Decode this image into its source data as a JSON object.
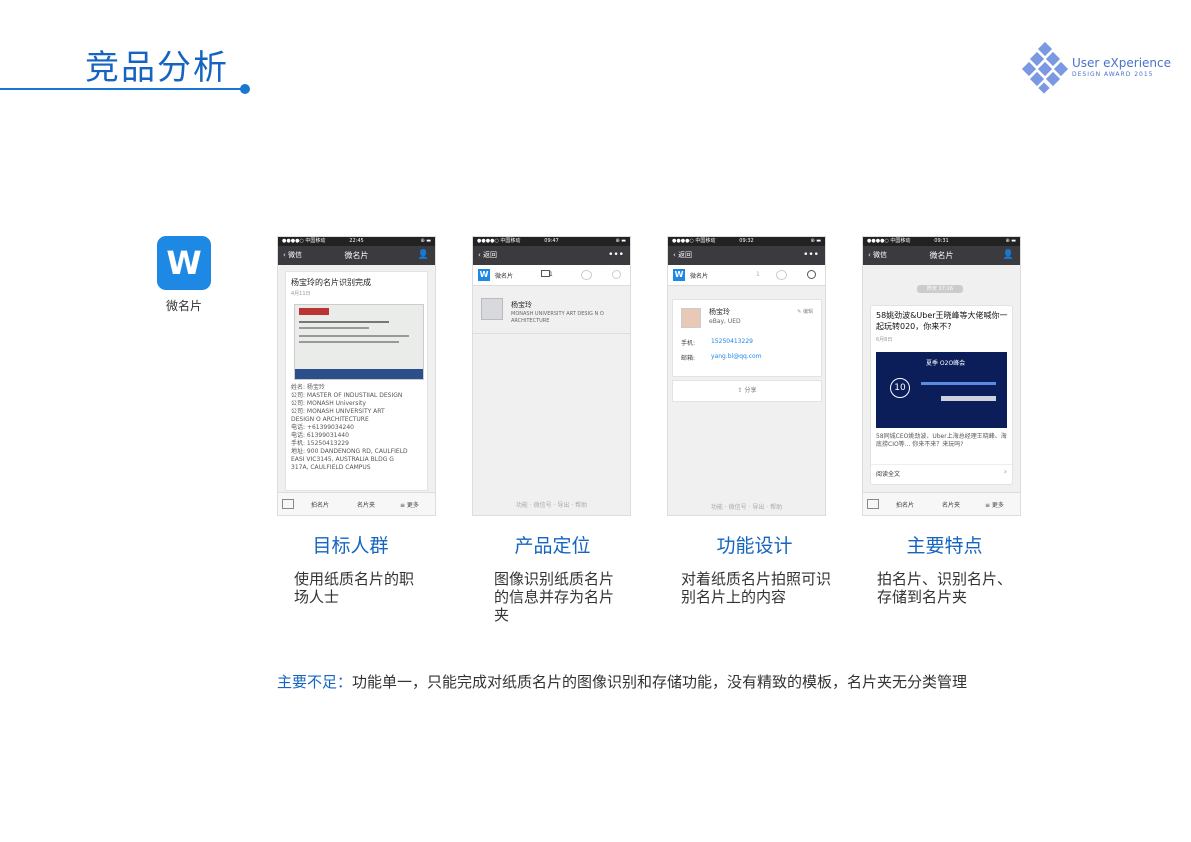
{
  "header": {
    "title": "竞品分析"
  },
  "logo": {
    "line1": "User eXperience",
    "line2": "DESIGN AWARD 2015"
  },
  "app": {
    "icon_letter": "W",
    "label": "微名片"
  },
  "phones": [
    {
      "status": {
        "carrier": "●●●●○ 中国移动 ",
        "time": "22:45",
        "battery": "⊕ ▬"
      },
      "nav": {
        "back": "‹ 微信",
        "title": "微名片",
        "right": "👤"
      },
      "card_title": "杨宝玲的名片识别完成",
      "card_date": "4月11日",
      "fields": [
        "姓名: 杨宝玲",
        "公司: MASTER OF INDUSTIIAL DESIGN",
        "公司: MONASH University",
        "公司: MONASH UNIVERSITY ART",
        "DESIGN O ARCHITECTURE",
        "电话: +61399034240",
        "电话: 61399031440",
        "手机: 15250413229",
        "地址: 900 DANDENONG RD, CAULFIELD",
        "EASI VIC3145, AUSTRALIA BLDG G",
        "317A, CAULFIELD CAMPUS"
      ],
      "tabs": [
        "拍名片",
        "名片夹",
        "≡ 更多"
      ]
    },
    {
      "status": {
        "carrier": "●●●●○ 中国移动 ",
        "time": "09:47",
        "battery": "⊕ ▬"
      },
      "nav": {
        "back": "‹ 返回",
        "title": "",
        "right": "•••"
      },
      "subhdr": {
        "name": "微名片",
        "count": "1"
      },
      "contact_name": "杨宝玲",
      "contact_org": "MONASH UNIVERSITY ART DESIG N O ARCHITECTURE",
      "footer": "功能 · 微信号 · 导出 · 帮助"
    },
    {
      "status": {
        "carrier": "●●●●○ 中国移动 ",
        "time": "09:32",
        "battery": "⊕ ▬"
      },
      "nav": {
        "back": "‹ 返回",
        "title": "",
        "right": "•••"
      },
      "subhdr": {
        "name": "微名片",
        "count": "1"
      },
      "contact_name": "杨宝玲",
      "contact_org": "eBay, UED",
      "edit": "✎ 编辑",
      "phone_label": "手机:",
      "phone_value": "15250413229",
      "email_label": "邮箱:",
      "email_value": "yang.bl@qq.com",
      "share": "⇪ 分享",
      "footer": "功能 · 微信号 · 导出 · 帮助"
    },
    {
      "status": {
        "carrier": "●●●●○ 中国移动 ",
        "time": "09:31",
        "battery": "⊕ ▬"
      },
      "nav": {
        "back": "‹ 微信",
        "title": "微名片",
        "right": "👤"
      },
      "timestamp": "昨天 17:16",
      "article_title": "58姚劲波&Uber王晓峰等大佬喊你一起玩转020，你来不?",
      "article_date": "6月8日",
      "banner_text": "夏季 O2O峰会",
      "banner_num": "10",
      "article_desc": "58同城CEO姚劲波、Uber上海总经理王晓峰、海底捞CIO等... 你来不来？来玩吗?",
      "read_more": "阅读全文",
      "tabs": [
        "拍名片",
        "名片夹",
        "≡ 更多"
      ]
    }
  ],
  "sections": [
    {
      "title": "目标人群",
      "desc": "使用纸质名片的职场人士"
    },
    {
      "title": "产品定位",
      "desc": "图像识别纸质名片的信息并存为名片夹"
    },
    {
      "title": "功能设计",
      "desc": "对着纸质名片拍照可识别名片上的内容"
    },
    {
      "title": "主要特点",
      "desc": "拍名片、识别名片、存储到名片夹"
    }
  ],
  "bottom_note": {
    "label": "主要不足：",
    "text": "功能单一，只能完成对纸质名片的图像识别和存储功能，没有精致的模板，名片夹无分类管理"
  },
  "colors": {
    "accent": "#1565c0",
    "app_icon": "#1e88e5",
    "navbar": "#3a3a3f"
  }
}
